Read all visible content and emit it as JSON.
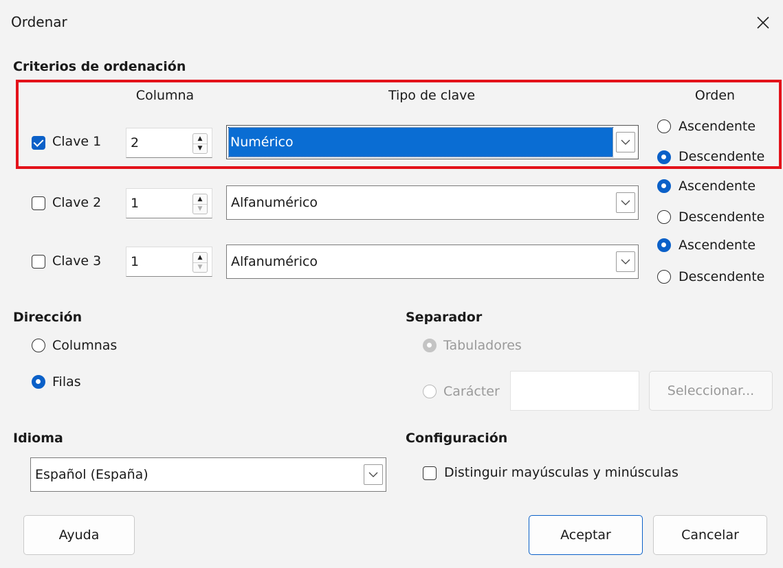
{
  "window": {
    "title": "Ordenar"
  },
  "criteria": {
    "section_label": "Criterios de ordenación",
    "col_header": "Columna",
    "type_header": "Tipo de clave",
    "order_header": "Orden",
    "keys": [
      {
        "label": "Clave 1",
        "checked": true,
        "column": "2",
        "type": "Numérico",
        "order": "Descendente"
      },
      {
        "label": "Clave 2",
        "checked": false,
        "column": "1",
        "type": "Alfanumérico",
        "order": "Ascendente"
      },
      {
        "label": "Clave 3",
        "checked": false,
        "column": "1",
        "type": "Alfanumérico",
        "order": "Ascendente"
      }
    ],
    "ascending_label": "Ascendente",
    "descending_label": "Descendente"
  },
  "direction": {
    "section_label": "Dirección",
    "columns_label": "Columnas",
    "rows_label": "Filas",
    "selected": "Filas"
  },
  "separator": {
    "section_label": "Separador",
    "tabs_label": "Tabuladores",
    "char_label": "Carácter",
    "char_value": "",
    "select_button": "Seleccionar..."
  },
  "language": {
    "section_label": "Idioma",
    "value": "Español (España)"
  },
  "settings": {
    "section_label": "Configuración",
    "case_label": "Distinguir mayúsculas y minúsculas",
    "case_checked": false
  },
  "buttons": {
    "help": "Ayuda",
    "ok": "Aceptar",
    "cancel": "Cancelar"
  },
  "colors": {
    "accent": "#0a60c8",
    "highlight": "#0a6dd3",
    "annotation_box": "#e3121a"
  }
}
